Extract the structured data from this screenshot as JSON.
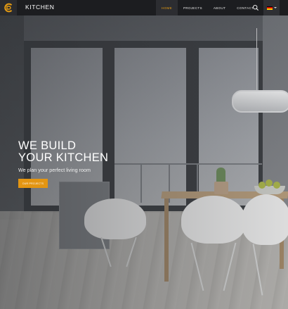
{
  "brand": {
    "logo_icon": "c-logo-icon",
    "name": "KITCHEN"
  },
  "nav": {
    "items": [
      {
        "label": "HOME",
        "active": true
      },
      {
        "label": "PROJECTS",
        "active": false
      },
      {
        "label": "ABOUT",
        "active": false
      },
      {
        "label": "CONTACT",
        "active": false
      }
    ],
    "search_icon": "search-icon",
    "language_icon": "flag-germany-icon"
  },
  "hero": {
    "title_line1": "WE BUILD",
    "title_line2": "YOUR KITCHEN",
    "subtitle": "We plan your perfect living room",
    "cta_label": "OUR PROJECTS"
  },
  "colors": {
    "accent": "#e39512",
    "navbar": "#1c1d20",
    "active_nav_bg": "#2c2d31"
  }
}
